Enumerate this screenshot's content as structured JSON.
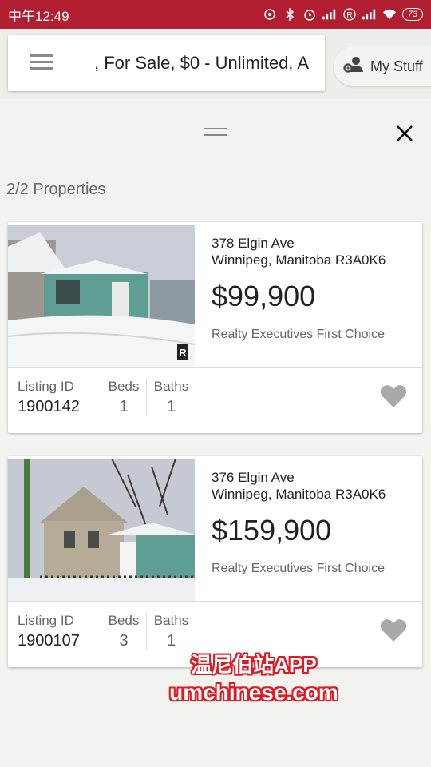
{
  "status_bar": {
    "time": "中午12:49",
    "battery": "73",
    "bg_color": "#b01e2f"
  },
  "search": {
    "text": ", For Sale, $0 - Unlimited, A"
  },
  "my_stuff": {
    "label": "My Stuff"
  },
  "results": {
    "count_label": "2/2 Properties"
  },
  "listings": [
    {
      "address_line1": "378 Elgin Ave",
      "address_line2": "Winnipeg, Manitoba R3A0K6",
      "price": "$99,900",
      "brokerage": "Realty Executives First Choice",
      "listing_id_label": "Listing ID",
      "listing_id": "1900142",
      "beds_label": "Beds",
      "beds": "1",
      "baths_label": "Baths",
      "baths": "1",
      "favorite_icon": "heart-icon"
    },
    {
      "address_line1": "376 Elgin Ave",
      "address_line2": "Winnipeg, Manitoba R3A0K6",
      "price": "$159,900",
      "brokerage": "Realty Executives First Choice",
      "listing_id_label": "Listing ID",
      "listing_id": "1900107",
      "beds_label": "Beds",
      "beds": "3",
      "baths_label": "Baths",
      "baths": "1",
      "favorite_icon": "heart-icon"
    }
  ],
  "watermark": {
    "line1": "温尼伯站APP",
    "line2": "umchinese.com",
    "color": "#e01a22"
  }
}
